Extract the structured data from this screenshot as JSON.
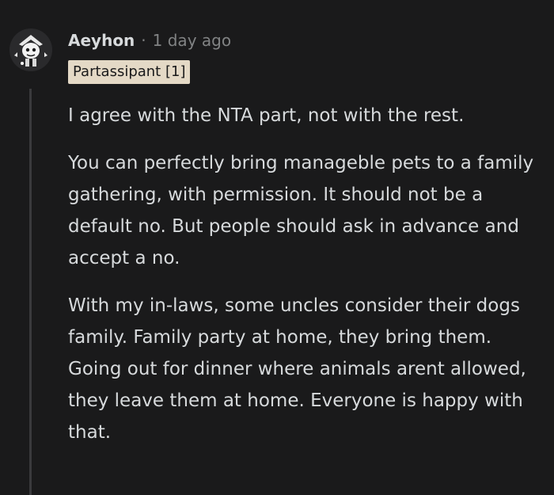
{
  "comment": {
    "author": "Aeyhon",
    "separator": "·",
    "timestamp": "1 day ago",
    "flair": "Partassipant [1]",
    "paragraphs": [
      "I agree with the NTA part, not with the rest.",
      "You can perfectly bring manageble pets to a family gathering, with permission. It should not be a default no. But people should ask in advance and accept a no.",
      "With my in-laws, some uncles consider their dogs family. Family party at home, they bring them. Going out for dinner where animals arent allowed, they leave them at home. Everyone is happy with that."
    ]
  },
  "colors": {
    "background": "#1a1a1b",
    "text": "#d7dadc",
    "meta": "#818384",
    "flair_bg": "#e4d9c6",
    "thread_line": "#3a3a3c"
  },
  "icons": {
    "avatar": "user-avatar-icon"
  }
}
